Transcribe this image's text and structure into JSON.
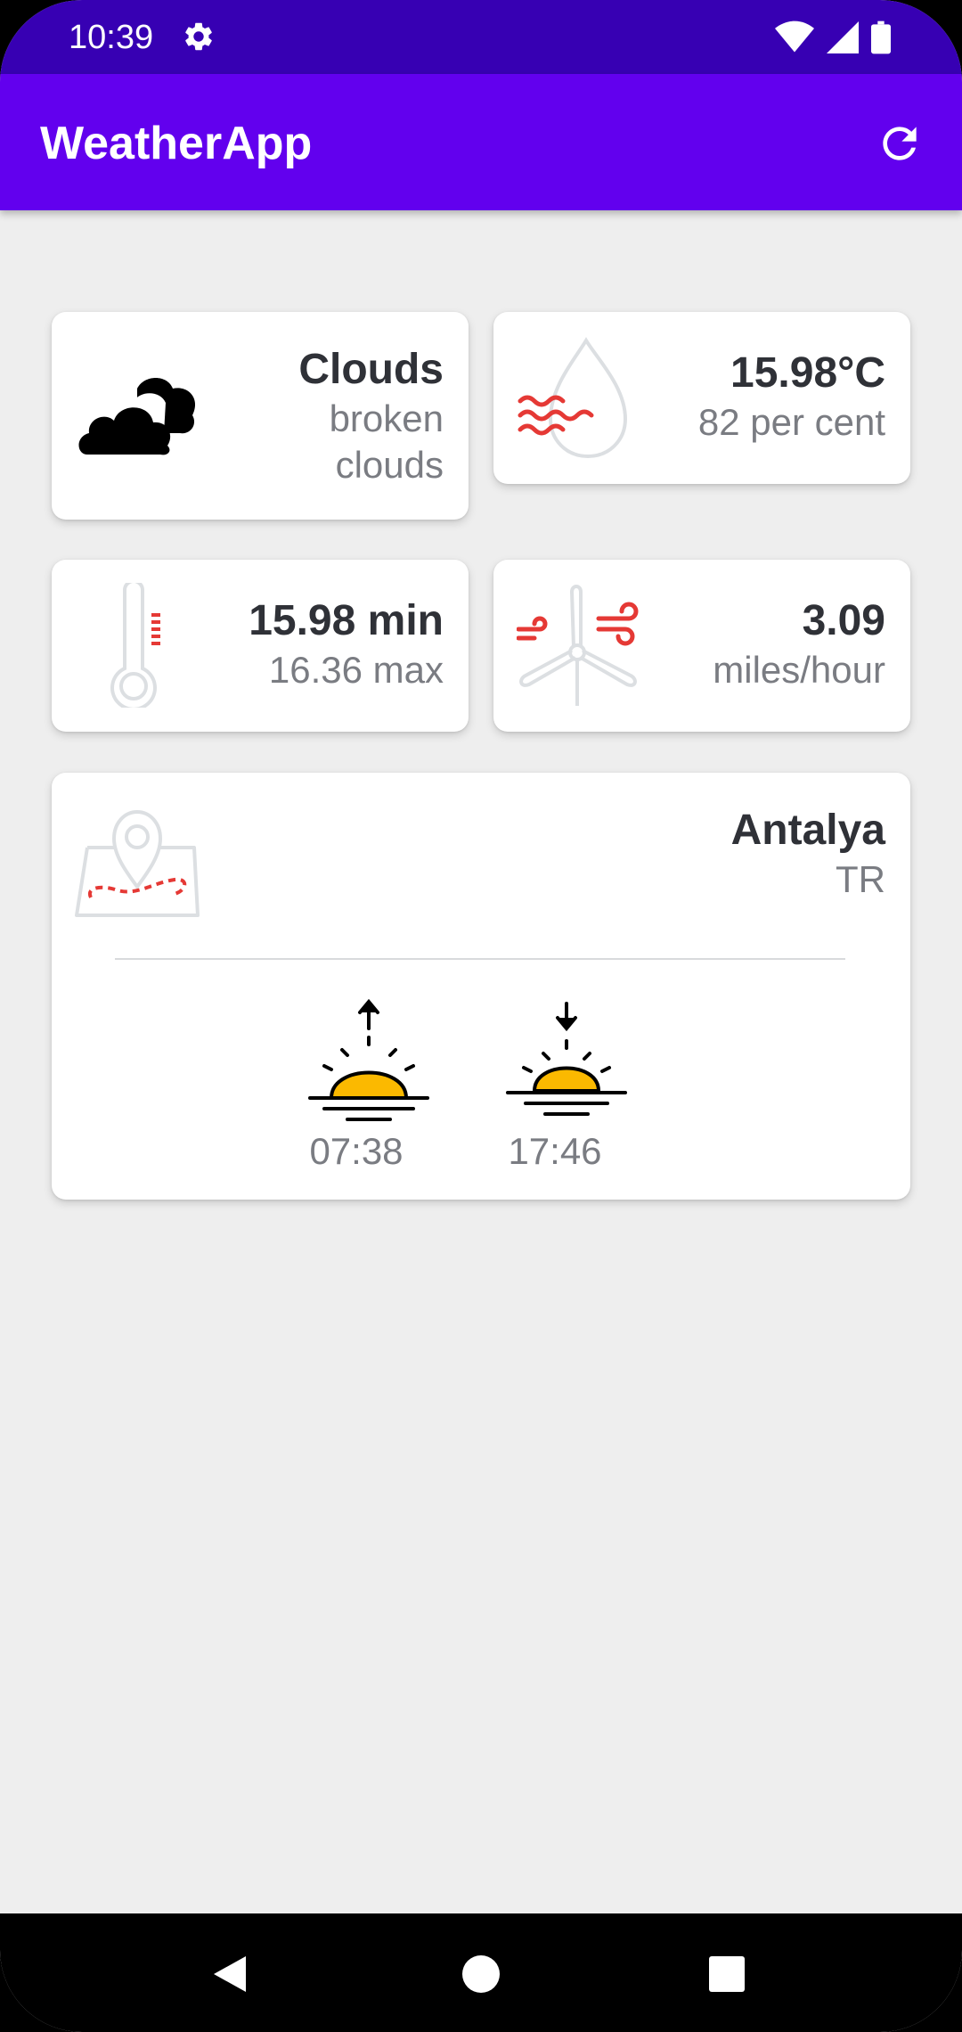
{
  "status_bar": {
    "time": "10:39",
    "icons": [
      "settings-icon",
      "wifi-icon",
      "signal-icon",
      "battery-icon"
    ]
  },
  "app_bar": {
    "title": "WeatherApp",
    "refresh_icon": "refresh-icon"
  },
  "weather_card": {
    "main": "Clouds",
    "description_line1": "broken",
    "description_line2": "clouds",
    "icon": "clouds-icon"
  },
  "humidity_card": {
    "temperature": "15.98°C",
    "humidity": "82 per cent",
    "icon": "humidity-drop-icon"
  },
  "minmax_card": {
    "min": "15.98 min",
    "max": "16.36 max",
    "icon": "thermometer-icon"
  },
  "wind_card": {
    "speed": "3.09",
    "unit": "miles/hour",
    "icon": "wind-turbine-icon"
  },
  "location_card": {
    "city": "Antalya",
    "country": "TR",
    "icon": "map-pin-icon",
    "sunrise": "07:38",
    "sunset": "17:46"
  },
  "colors": {
    "status_bar": "#3700b3",
    "app_bar": "#6200ee",
    "background": "#eeeeee",
    "accent_red": "#e53935",
    "sun_yellow": "#fbb900"
  }
}
